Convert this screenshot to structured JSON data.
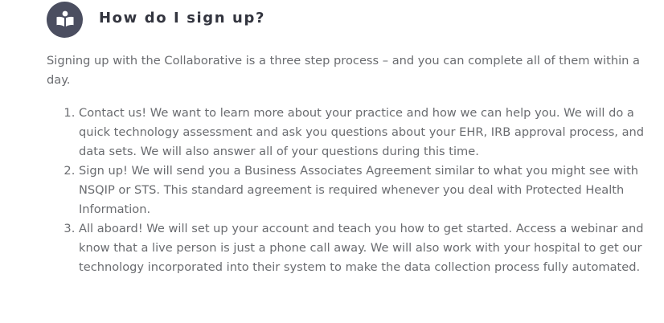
{
  "faq": {
    "icon": "open-book-reader-icon",
    "icon_bg_color": "#4b4e60",
    "title": "How do I sign up?",
    "intro": "Signing up with the Collaborative is a three step process – and you can complete all of them within a day.",
    "steps": [
      "Contact us! We want to learn more about your practice and how we can help you. We will do a quick technology assessment and ask you questions about your EHR, IRB approval process, and data sets. We will also answer all of your questions during this time.",
      "Sign up! We will send you a Business Associates Agreement similar to what you might see with NSQIP or STS. This standard agreement is required whenever you deal with Protected Health Information.",
      "All aboard! We will set up your account and teach you how to get started. Access a webinar and know that a live person is just a phone call away. We will also work with your hospital to get our technology incorporated into their system to make the data collection process fully automated."
    ]
  }
}
